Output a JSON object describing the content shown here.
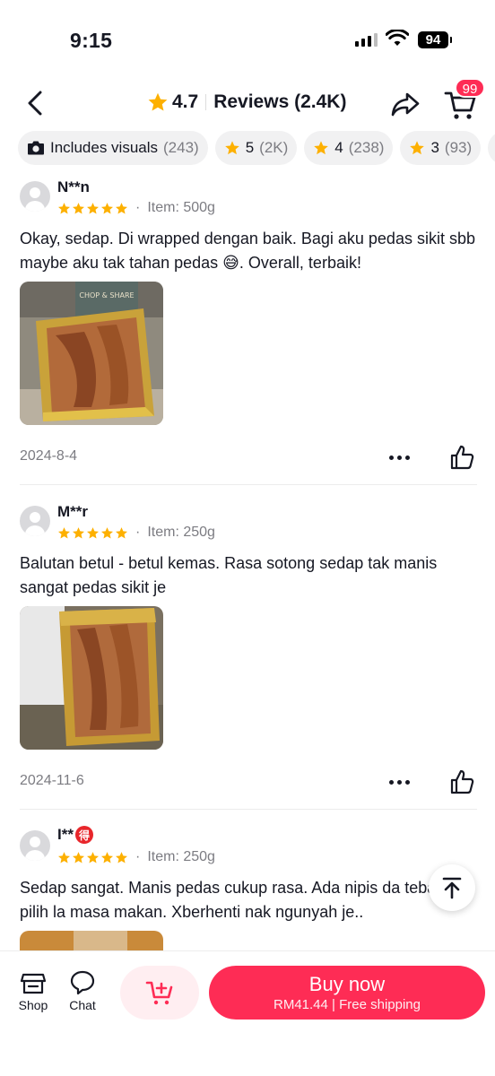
{
  "status_bar": {
    "time": "9:15",
    "battery": "94"
  },
  "header": {
    "rating": "4.7",
    "title": "Reviews (2.4K)",
    "cart_badge": "99"
  },
  "filters": [
    {
      "label": "Includes visuals",
      "count": "(243)",
      "icon": "camera-icon"
    },
    {
      "label": "5",
      "count": "(2K)",
      "icon": "star-icon"
    },
    {
      "label": "4",
      "count": "(238)",
      "icon": "star-icon"
    },
    {
      "label": "3",
      "count": "(93)",
      "icon": "star-icon"
    }
  ],
  "reviews": [
    {
      "name": "N**n",
      "rating": 5,
      "item": "Item: 500g",
      "text": "Okay, sedap. Di wrapped dengan baik. Bagi aku pedas sikit sbb maybe aku tak tahan pedas 😅. Overall, terbaik!",
      "date": "2024-8-4",
      "photo_label": "CHOP & SHARE"
    },
    {
      "name": "M**r",
      "rating": 5,
      "item": "Item: 250g",
      "text": "Balutan betul - betul kemas. Rasa sotong sedap tak manis sangat pedas sikit je",
      "date": "2024-11-6"
    },
    {
      "name": "I**",
      "badge": "得",
      "rating": 5,
      "item": "Item: 250g",
      "text": "Sedap sangat. Manis pedas cukup rasa. Ada nipis da tebal pilih la masa makan. Xberhenti nak ngunyah je.."
    }
  ],
  "bottom_bar": {
    "shop_label": "Shop",
    "chat_label": "Chat",
    "buy_now": "Buy now",
    "price_info": "RM41.44 | Free shipping"
  },
  "colors": {
    "accent": "#fe2c55",
    "star": "#fdb000",
    "muted": "#7c7c82"
  }
}
